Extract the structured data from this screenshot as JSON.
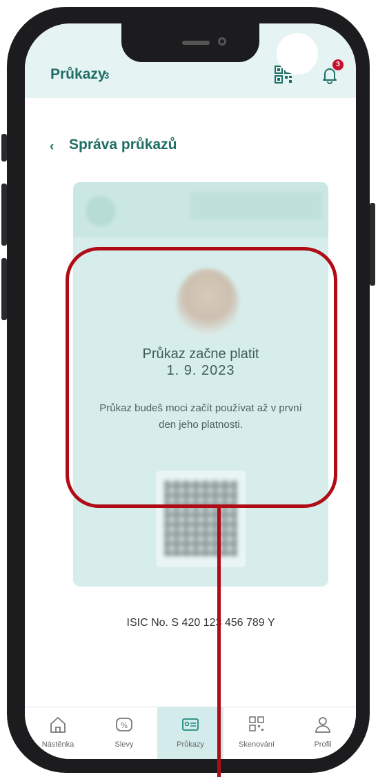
{
  "header": {
    "title": "Průkazy",
    "count": "3",
    "notifications": "3"
  },
  "page": {
    "back_icon": "‹",
    "title": "Správa průkazů"
  },
  "card_message": {
    "title": "Průkaz začne platit",
    "date": "1. 9. 2023",
    "text": "Průkaz budeš moci začít používat až v první den jeho platnosti."
  },
  "isic": "ISIC No.  S 420 123 456 789 Y",
  "nav": {
    "items": [
      {
        "label": "Nástěnka",
        "icon": "home-icon"
      },
      {
        "label": "Slevy",
        "icon": "discount-icon"
      },
      {
        "label": "Průkazy",
        "icon": "card-icon"
      },
      {
        "label": "Skenování",
        "icon": "qr-scan-icon"
      },
      {
        "label": "Profil",
        "icon": "user-icon"
      }
    ]
  },
  "colors": {
    "accent": "#1f6e64",
    "highlight": "#b00c17",
    "header_bg": "#e6f3f3"
  }
}
